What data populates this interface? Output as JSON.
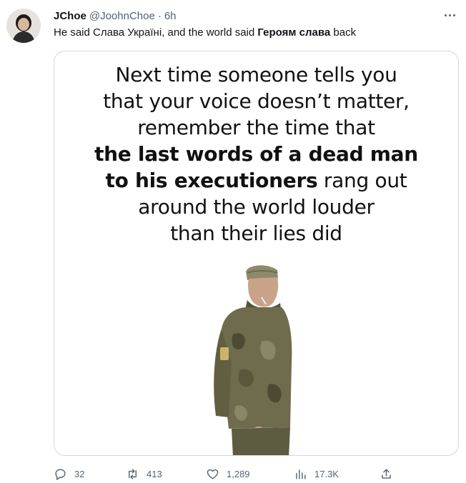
{
  "tweet": {
    "author_name": "JChoe",
    "author_handle": "@JoohnChoe",
    "separator": "·",
    "time": "6h",
    "text_part1": "He said Слава Україні, and the world said ",
    "text_bold": "Героям слава",
    "text_part2": " back"
  },
  "media": {
    "line1": "Next time someone tells you",
    "line2": "that your voice doesn’t matter,",
    "line3": "remember the time that",
    "line4": "the last words of a dead man",
    "line5_bold": "to his executioners",
    "line5_rest": " rang out",
    "line6": "around the world louder",
    "line7": "than their lies did"
  },
  "actions": {
    "replies": "32",
    "retweets": "413",
    "likes": "1,289",
    "views": "17.3K"
  },
  "icons": [
    "more-icon",
    "reply-icon",
    "retweet-icon",
    "like-icon",
    "views-icon",
    "share-icon"
  ],
  "colors": {
    "secondary_text": "#536471",
    "border": "#cfd9de"
  }
}
